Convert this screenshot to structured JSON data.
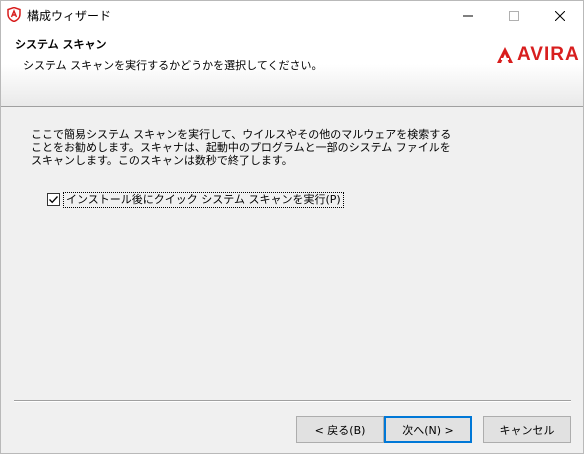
{
  "window": {
    "title": "構成ウィザード"
  },
  "header": {
    "title": "システム スキャン",
    "subtitle": "システム スキャンを実行するかどうかを選択してください。",
    "logo_text": "AVIRA"
  },
  "body": {
    "description": "ここで簡易システム スキャンを実行して、ウイルスやその他のマルウェアを検索することをお勧めします。スキャナは、起動中のプログラムと一部のシステム ファイルをスキャンします。このスキャンは数秒で終了します。",
    "quick_scan_checkbox": {
      "label": "インストール後にクイック システム スキャンを実行(P)",
      "checked": true
    }
  },
  "buttons": {
    "back": "< 戻る(B)",
    "next": "次へ(N) >",
    "cancel": "キャンセル"
  },
  "colors": {
    "brand": "#d81e1e",
    "focus": "#0078d7"
  }
}
